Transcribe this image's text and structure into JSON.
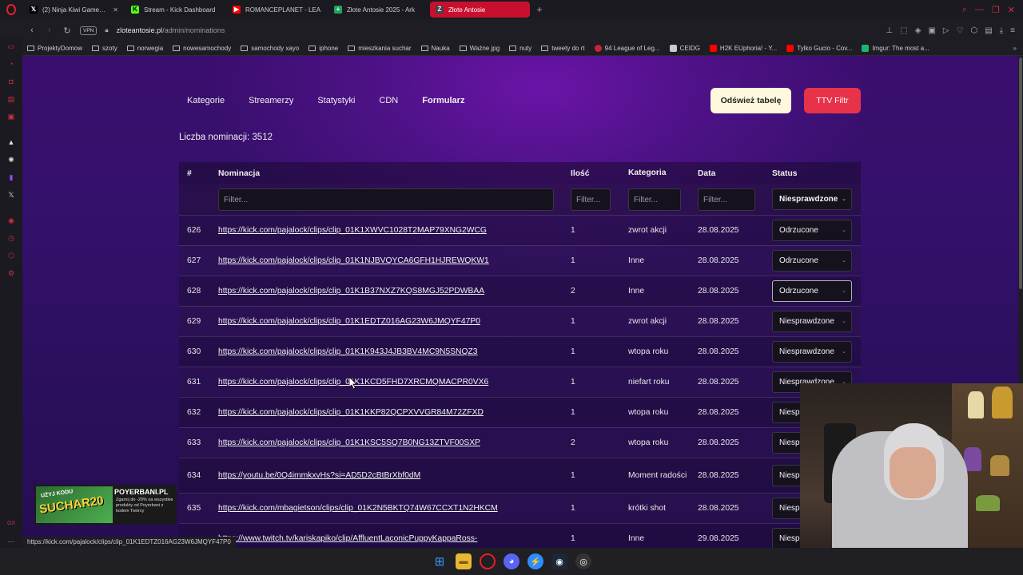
{
  "browser": {
    "tabs": [
      {
        "title": "(2) Ninja Kiwi Games w sę",
        "icon": "x-icon",
        "color": "#000000"
      },
      {
        "title": "Stream - Kick Dashboard",
        "icon": "kick-icon",
        "color": "#53fc18"
      },
      {
        "title": "ROMANCEPLANET - LEA",
        "icon": "youtube-icon",
        "color": "#ff0000"
      },
      {
        "title": "Złote Antosie 2025 - Ark",
        "icon": "sheets-icon",
        "color": "#1fa463"
      },
      {
        "title": "Złote Antosie",
        "icon": "za-icon",
        "color": "#444444"
      }
    ],
    "address": {
      "vpn": "VPN",
      "host": "zloteantosie.pl",
      "path": "/admin/nominations"
    },
    "bookmarks": [
      {
        "label": "ProjektyDomow",
        "type": "folder"
      },
      {
        "label": "szoty",
        "type": "folder"
      },
      {
        "label": "norwegia",
        "type": "folder"
      },
      {
        "label": "nowesamochody",
        "type": "folder"
      },
      {
        "label": "samochody xayo",
        "type": "folder"
      },
      {
        "label": "iphone",
        "type": "folder"
      },
      {
        "label": "mieszkania suchar",
        "type": "folder"
      },
      {
        "label": "Nauka",
        "type": "folder"
      },
      {
        "label": "Ważne jpg",
        "type": "folder"
      },
      {
        "label": "nuty",
        "type": "folder"
      },
      {
        "label": "tweety do rt",
        "type": "folder"
      },
      {
        "label": "94 League of Leg...",
        "type": "site"
      },
      {
        "label": "CEIDG",
        "type": "site"
      },
      {
        "label": "H2K EUphoria! - Y...",
        "type": "site"
      },
      {
        "label": "Tylko Gucio - Cov...",
        "type": "site"
      },
      {
        "label": "Imgur: The most a...",
        "type": "site"
      }
    ],
    "status_url": "https://kick.com/pajalock/clips/clip_01K1EDTZ016AG23W6JMQYF47P0"
  },
  "nav": {
    "items": [
      "Kategorie",
      "Streamerzy",
      "Statystyki",
      "CDN",
      "Formularz"
    ],
    "refresh_label": "Odśwież tabelę",
    "ttv_label": "TTV Filtr"
  },
  "count_label": "Liczba nominacji: 3512",
  "table": {
    "headers": {
      "id": "#",
      "nom": "Nominacja",
      "ilosc": "Ilość",
      "kat": "Kategoria",
      "data": "Data",
      "status": "Status"
    },
    "filters": {
      "nom": "Filter...",
      "ilosc": "Filter...",
      "kat": "Filter...",
      "data": "Filter...",
      "status": "Niesprawdzone"
    },
    "rows": [
      {
        "id": "626",
        "nom": "https://kick.com/pajalock/clips/clip_01K1XWVC1028T2MAP79XNG2WCG",
        "ilosc": "1",
        "kat": "zwrot akcji",
        "data": "28.08.2025",
        "status": "Odrzucone"
      },
      {
        "id": "627",
        "nom": "https://kick.com/pajalock/clips/clip_01K1NJBVQYCA6GFH1HJREWQKW1",
        "ilosc": "1",
        "kat": "Inne",
        "data": "28.08.2025",
        "status": "Odrzucone"
      },
      {
        "id": "628",
        "nom": "https://kick.com/pajalock/clips/clip_01K1B37NXZ7KQS8MGJ52PDWBAA",
        "ilosc": "2",
        "kat": "Inne",
        "data": "28.08.2025",
        "status": "Odrzucone"
      },
      {
        "id": "629",
        "nom": "https://kick.com/pajalock/clips/clip_01K1EDTZ016AG23W6JMQYF47P0",
        "ilosc": "1",
        "kat": "zwrot akcji",
        "data": "28.08.2025",
        "status": "Niesprawdzone"
      },
      {
        "id": "630",
        "nom": "https://kick.com/pajalock/clips/clip_01K1K943J4JB3BV4MC9N5SNQZ3",
        "ilosc": "1",
        "kat": "wtopa roku",
        "data": "28.08.2025",
        "status": "Niesprawdzone"
      },
      {
        "id": "631",
        "nom": "https://kick.com/pajalock/clips/clip_01K1KCD5FHD7XRCMQMACPR0VX6",
        "ilosc": "1",
        "kat": "niefart roku",
        "data": "28.08.2025",
        "status": "Niesprawdzone"
      },
      {
        "id": "632",
        "nom": "https://kick.com/pajalock/clips/clip_01K1KKP82QCPXVVGR84M72ZFXD",
        "ilosc": "1",
        "kat": "wtopa roku",
        "data": "28.08.2025",
        "status": "Niesprawdzone"
      },
      {
        "id": "633",
        "nom": "https://kick.com/pajalock/clips/clip_01K1KSC5SQ7B0NG13ZTVF00SXP",
        "ilosc": "2",
        "kat": "wtopa roku",
        "data": "28.08.2025",
        "status": "Niesprawdzone"
      },
      {
        "id": "634",
        "nom": "https://youtu.be/0Q4immkxvHs?si=AD5D2cBtBrXbf0dM",
        "ilosc": "1",
        "kat": "Moment radości",
        "data": "28.08.2025",
        "status": "Niesprawdzone"
      },
      {
        "id": "635",
        "nom": "https://kick.com/mbagietson/clips/clip_01K2N5BKTQ74W67CCXT1N2HKCM",
        "ilosc": "1",
        "kat": "krótki shot",
        "data": "28.08.2025",
        "status": "Niesprawdzone"
      },
      {
        "id": "",
        "nom": "https://www.twitch.tv/kariskapiko/clip/AffluentLaconicPuppyKappaRoss-",
        "ilosc": "1",
        "kat": "Inne",
        "data": "29.08.2025",
        "status": "Niesprawdzone"
      }
    ]
  },
  "ad": {
    "promo": "UŻYJ KODU",
    "code": "SUCHAR20",
    "brand": "POYERBANI.PL",
    "small": "Zgarnij do -20% na wszystkie produkty od Poyerbani z kodem Twórcy"
  },
  "colors": {
    "accent_red": "#e8324a",
    "refresh_bg": "#fff8dc",
    "page_purple": "#3b0e6e"
  }
}
